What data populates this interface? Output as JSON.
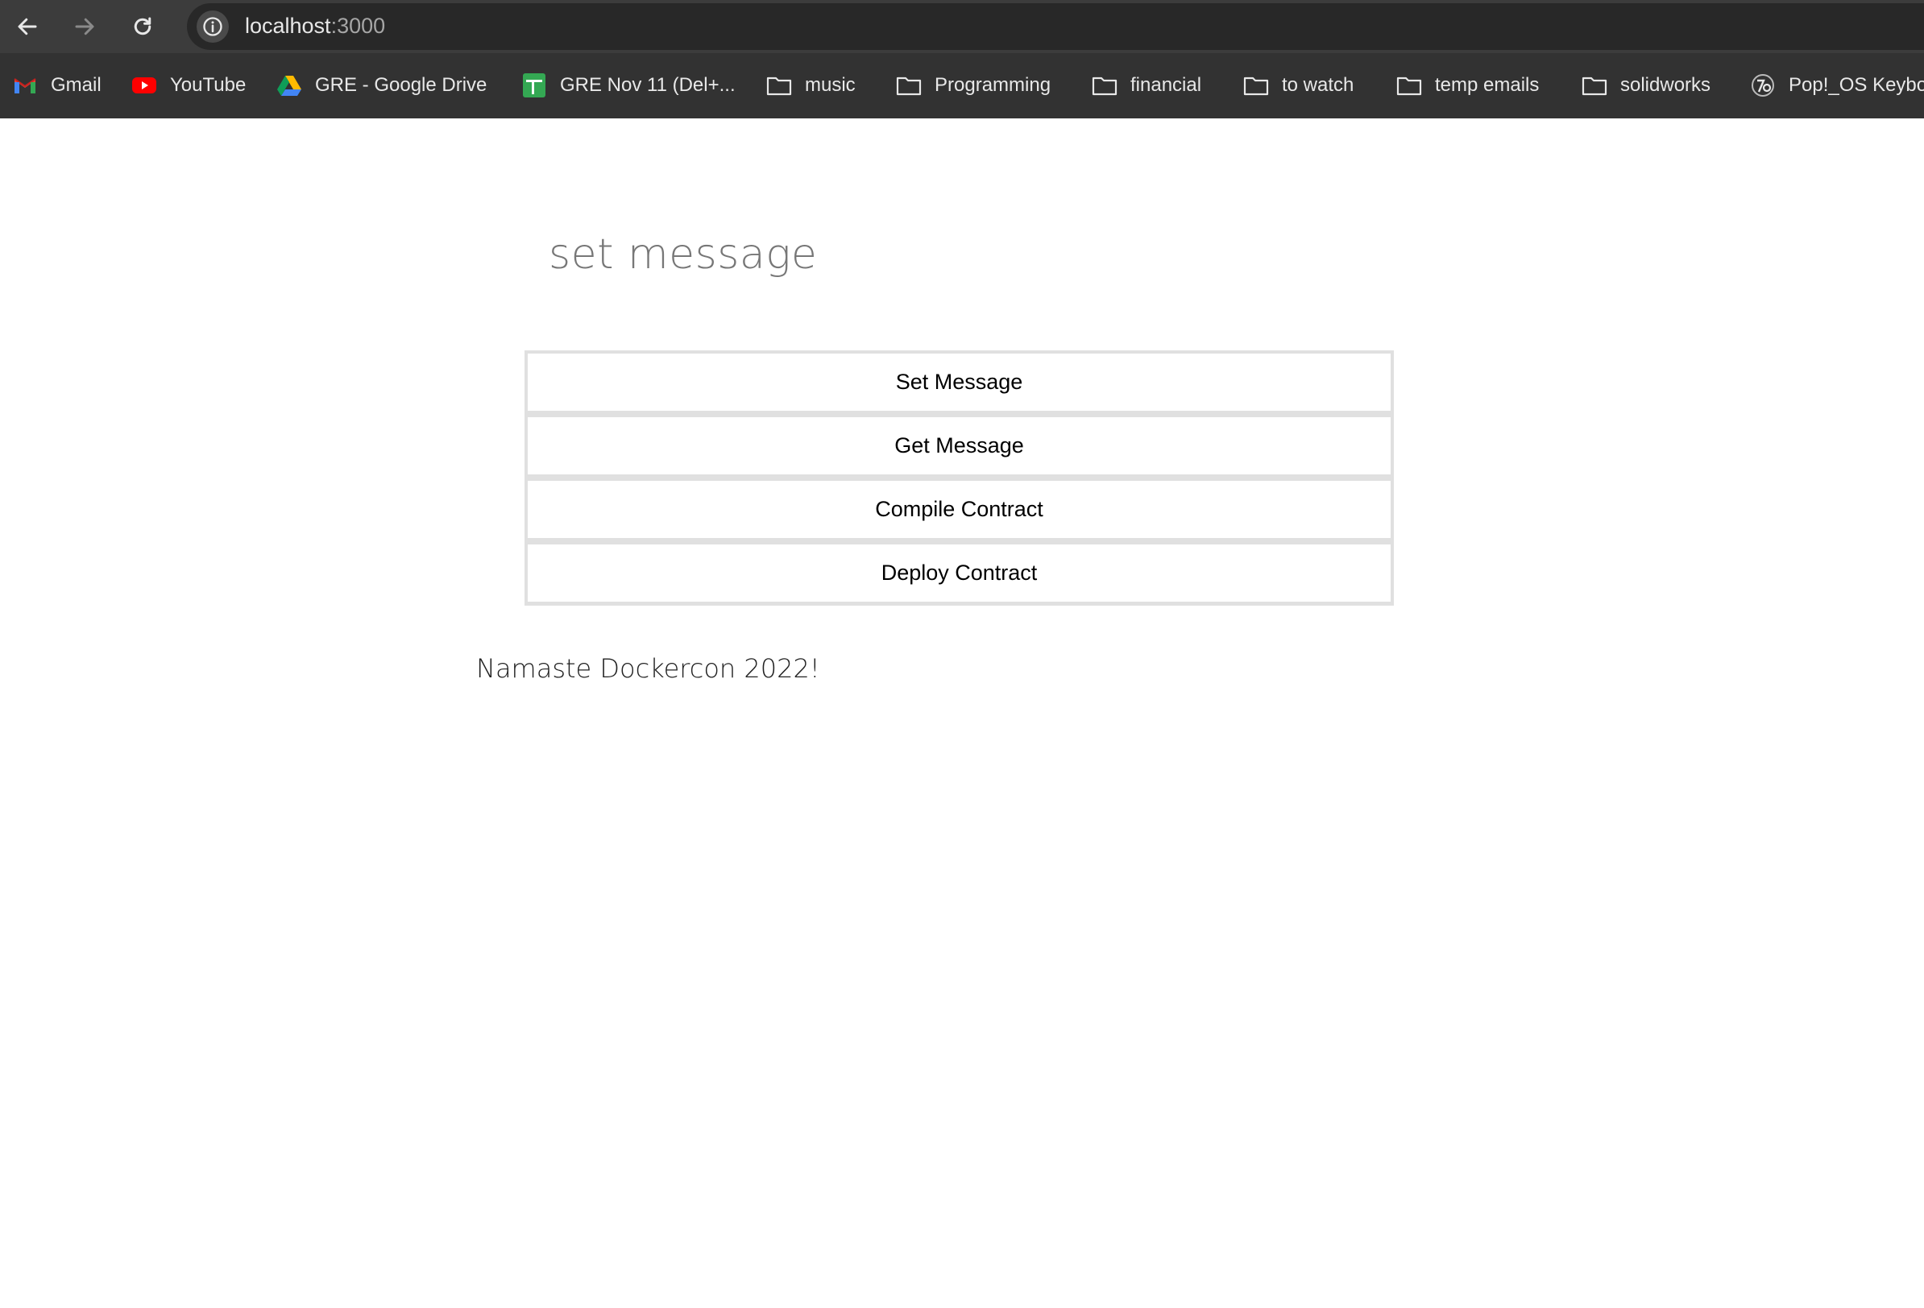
{
  "browser": {
    "url_host": "localhost",
    "url_port": ":3000",
    "bookmarks": [
      {
        "label": "Gmail",
        "icon": "gmail-icon"
      },
      {
        "label": "YouTube",
        "icon": "youtube-icon"
      },
      {
        "label": "GRE - Google Drive",
        "icon": "google-drive-icon"
      },
      {
        "label": "GRE Nov 11 (Del+...",
        "icon": "google-sheets-icon"
      },
      {
        "label": "music",
        "icon": "folder-icon"
      },
      {
        "label": "Programming",
        "icon": "folder-icon"
      },
      {
        "label": "financial",
        "icon": "folder-icon"
      },
      {
        "label": "to watch",
        "icon": "folder-icon"
      },
      {
        "label": "temp emails",
        "icon": "folder-icon"
      },
      {
        "label": "solidworks",
        "icon": "folder-icon"
      },
      {
        "label": "Pop!_OS Keybo",
        "icon": "pop-os-icon"
      }
    ]
  },
  "page": {
    "heading": "set message",
    "buttons": [
      {
        "label": "Set Message"
      },
      {
        "label": "Get Message"
      },
      {
        "label": "Compile Contract"
      },
      {
        "label": "Deploy Contract"
      }
    ],
    "message": "Namaste Dockercon 2022!"
  },
  "colors": {
    "toolbar": "#3c3c3c",
    "bookmarks_bar": "#323232",
    "button_group_border": "#e0e0e0",
    "heading_text": "#777777"
  }
}
